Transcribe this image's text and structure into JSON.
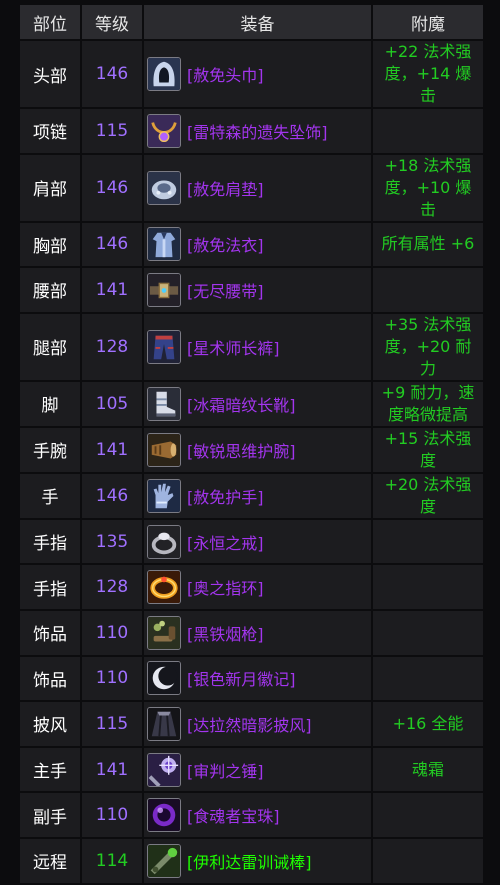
{
  "headers": {
    "slot": "部位",
    "level": "等级",
    "gear": "装备",
    "enchant": "附魔"
  },
  "rows": [
    {
      "slot": "头部",
      "level": "146",
      "item": "[赦免头巾]",
      "enchant": "+22 法术强度，+14 爆击",
      "icon": "hood-icon"
    },
    {
      "slot": "项链",
      "level": "115",
      "item": "[雷特森的遗失坠饰]",
      "enchant": "",
      "icon": "necklace-icon"
    },
    {
      "slot": "肩部",
      "level": "146",
      "item": "[赦免肩垫]",
      "enchant": "+18 法术强度，+10 爆击",
      "icon": "shoulder-icon"
    },
    {
      "slot": "胸部",
      "level": "146",
      "item": "[赦免法衣]",
      "enchant": "所有属性 +6",
      "icon": "robe-icon"
    },
    {
      "slot": "腰部",
      "level": "141",
      "item": "[无尽腰带]",
      "enchant": "",
      "icon": "belt-icon"
    },
    {
      "slot": "腿部",
      "level": "128",
      "item": "[星术师长裤]",
      "enchant": "+35 法术强度，+20 耐力",
      "icon": "pants-icon"
    },
    {
      "slot": "脚",
      "level": "105",
      "item": "[冰霜暗纹长靴]",
      "enchant": "+9 耐力，速度略微提高",
      "icon": "boots-icon"
    },
    {
      "slot": "手腕",
      "level": "141",
      "item": "[敏锐思维护腕]",
      "enchant": "+15 法术强度",
      "icon": "bracer-icon"
    },
    {
      "slot": "手",
      "level": "146",
      "item": "[赦免护手]",
      "enchant": "+20 法术强度",
      "icon": "gloves-icon"
    },
    {
      "slot": "手指",
      "level": "135",
      "item": "[永恒之戒]",
      "enchant": "",
      "icon": "ring-icon"
    },
    {
      "slot": "手指",
      "level": "128",
      "item": "[奥之指环]",
      "enchant": "",
      "icon": "gold-ring-icon"
    },
    {
      "slot": "饰品",
      "level": "110",
      "item": "[黑铁烟枪]",
      "enchant": "",
      "icon": "smoke-pipe-icon"
    },
    {
      "slot": "饰品",
      "level": "110",
      "item": "[银色新月徽记]",
      "enchant": "",
      "icon": "crescent-moon-icon"
    },
    {
      "slot": "披风",
      "level": "115",
      "item": "[达拉然暗影披风]",
      "enchant": "+16 全能",
      "icon": "cloak-icon"
    },
    {
      "slot": "主手",
      "level": "141",
      "item": "[审判之锤]",
      "enchant": "魂霜",
      "icon": "mace-icon"
    },
    {
      "slot": "副手",
      "level": "110",
      "item": "[食魂者宝珠]",
      "enchant": "",
      "icon": "orb-icon"
    },
    {
      "slot": "远程",
      "level": "114",
      "item": "[伊利达雷训诫棒]",
      "enchant": "",
      "icon": "wand-icon",
      "rarity": "uncommon"
    }
  ],
  "colors": {
    "epic": "#a335ee",
    "uncommon": "#1eff00",
    "level_epic": "#a070ff",
    "level_uncommon": "#22cc22",
    "enchant": "#22cc22",
    "enchant_special": "#ffd200"
  }
}
